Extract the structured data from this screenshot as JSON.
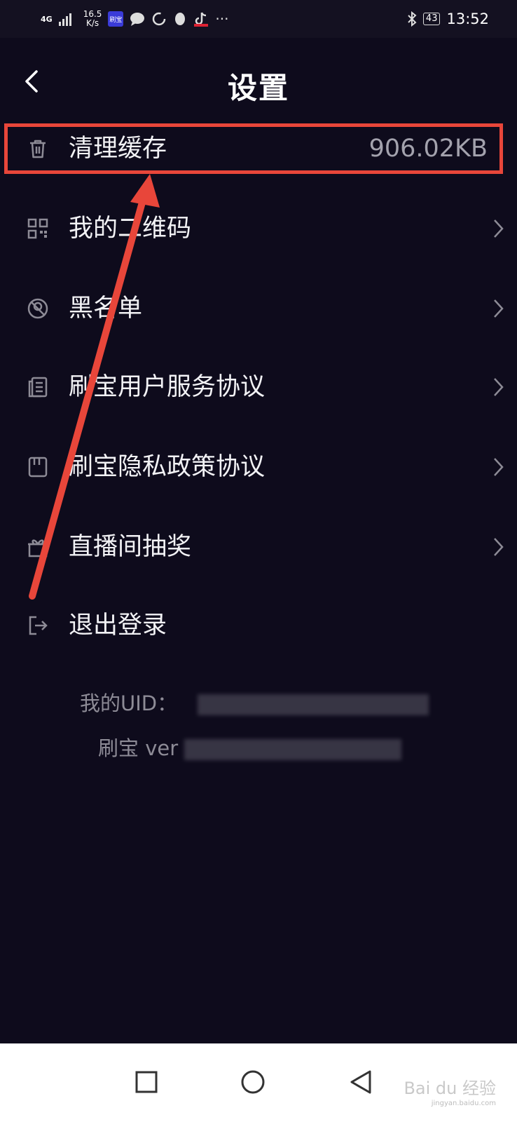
{
  "status_bar": {
    "signal": "4G",
    "speed": "16.5",
    "speed_unit": "K/s",
    "app_badge": "刷宝",
    "more": "···",
    "battery": "43",
    "time": "13:52"
  },
  "header": {
    "title": "设置"
  },
  "menu": {
    "items": [
      {
        "icon": "trash-icon",
        "label": "清理缓存",
        "value": "906.02KB"
      },
      {
        "icon": "qr-code-icon",
        "label": "我的二维码"
      },
      {
        "icon": "blocked-user-icon",
        "label": "黑名单"
      },
      {
        "icon": "document-icon",
        "label": "刷宝用户服务协议"
      },
      {
        "icon": "book-icon",
        "label": "刷宝隐私政策协议"
      },
      {
        "icon": "gift-icon",
        "label": "直播间抽奖"
      },
      {
        "icon": "logout-icon",
        "label": "退出登录"
      }
    ]
  },
  "info": {
    "uid_label": "我的UID：",
    "version_label": "刷宝 ver"
  },
  "colors": {
    "background": "#0e0b1c",
    "annotation": "#e8463a"
  },
  "watermark": {
    "text": "Bai du 经验",
    "sub": "jingyan.baidu.com"
  }
}
